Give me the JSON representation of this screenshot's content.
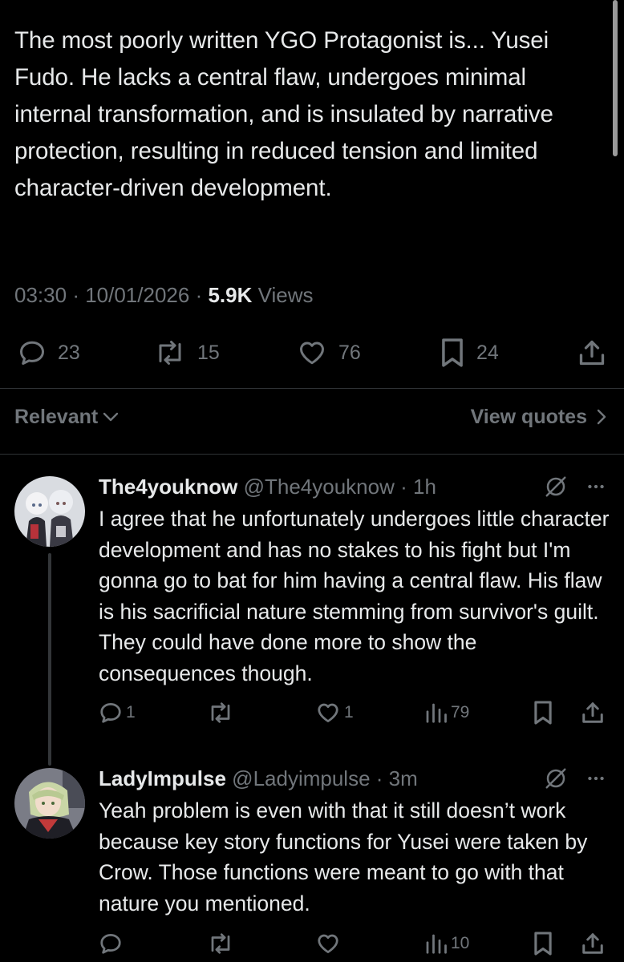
{
  "tweet": {
    "text": "The most poorly written YGO Protagonist is... Yusei Fudo. He lacks a central flaw, undergoes minimal internal transformation, and is insulated by narrative protection, resulting in reduced tension and limited character-driven development.",
    "time": "03:30",
    "date": "10/01/2026",
    "separator": "·",
    "views_count": "5.9K",
    "views_label": "Views",
    "stats": {
      "replies": "23",
      "reposts": "15",
      "likes": "76",
      "bookmarks": "24"
    }
  },
  "sort": {
    "left_label": "Relevant",
    "right_label": "View quotes"
  },
  "replies": [
    {
      "name": "The4youknow",
      "handle": "@The4youknow",
      "time": "1h",
      "text": "I agree that he unfortunately undergoes little character development and has no stakes to his fight but I'm gonna go to bat for him having a central flaw. His flaw is his sacrificial nature stemming from survivor's guilt. They could have done more to show the consequences though.",
      "replies": "1",
      "likes": "1",
      "views": "79"
    },
    {
      "name": "LadyImpulse",
      "handle": "@Ladyimpulse",
      "time": "3m",
      "text": "Yeah problem is even with that it still doesn’t work because key story functions for Yusei were taken by Crow. Those functions were meant to go with that nature you mentioned.",
      "views": "10"
    }
  ],
  "icons": [
    "reply-icon",
    "repost-icon",
    "like-icon",
    "bookmark-icon",
    "share-icon",
    "grok-icon",
    "more-icon",
    "views-icon",
    "chevron-down-icon",
    "chevron-right-icon"
  ],
  "colors": {
    "background": "#000000",
    "text": "#e7e9ea",
    "muted": "#71767b",
    "divider": "#2f3336"
  }
}
